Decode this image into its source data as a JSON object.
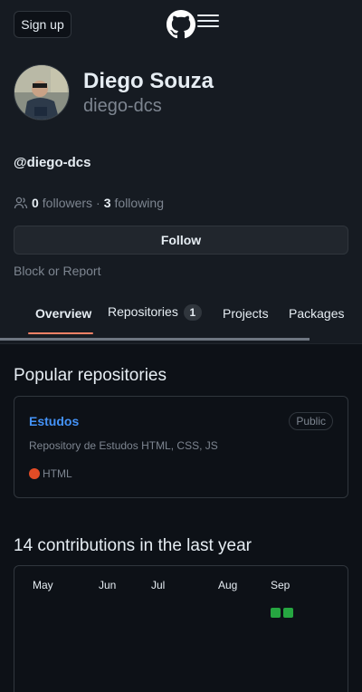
{
  "header": {
    "signup_label": "Sign up",
    "logo_icon": "github-logo-icon",
    "menu_icon": "hamburger-menu-icon"
  },
  "profile": {
    "name": "Diego Souza",
    "login": "diego-dcs",
    "handle": "@diego-dcs",
    "followers_count": "0",
    "followers_label": "followers",
    "separator": "·",
    "following_count": "3",
    "following_label": "following",
    "follow_label": "Follow",
    "block_report_label": "Block or Report"
  },
  "tabs": [
    {
      "label": "Overview",
      "active": true
    },
    {
      "label": "Repositories",
      "count": "1"
    },
    {
      "label": "Projects"
    },
    {
      "label": "Packages"
    }
  ],
  "popular": {
    "title": "Popular repositories",
    "repos": [
      {
        "name": "Estudos",
        "visibility": "Public",
        "description": "Repository de Estudos HTML, CSS, JS",
        "language": "HTML",
        "language_color": "#e34c26"
      }
    ]
  },
  "contributions": {
    "title": "14 contributions in the last year",
    "months": [
      "May",
      "Jun",
      "Jul",
      "Aug",
      "Sep"
    ],
    "cell_color": "#26a641"
  },
  "colors": {
    "accent_underline": "#f78166",
    "link": "#4493f8",
    "bg": "#0d1117",
    "surface": "#161b22"
  }
}
